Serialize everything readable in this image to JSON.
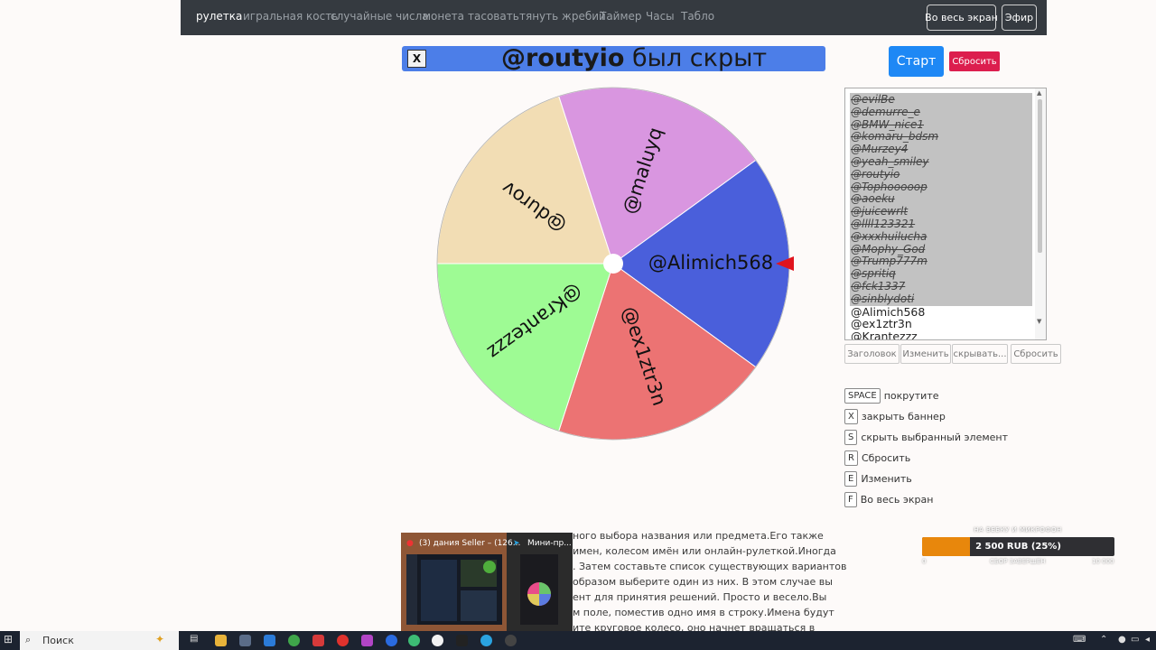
{
  "nav": {
    "items": [
      "рулетка",
      "игральная кость",
      "случайные числа",
      "монета",
      "тасовать",
      "тянуть жребий",
      "Таймер",
      "Часы",
      "Табло"
    ],
    "fullscreen_label": "Во весь экран",
    "broadcast_label": "Эфир"
  },
  "banner": {
    "close_label": "X",
    "name": "@routyio",
    "suffix": " был скрыт"
  },
  "wheel": {
    "segments": [
      {
        "label": "@Alimich568",
        "color": "#4a5fdb"
      },
      {
        "label": "@ex1ztr3n",
        "color": "#ec7373"
      },
      {
        "label": "@Krantezzz",
        "color": "#9efb94"
      },
      {
        "label": "@durov",
        "color": "#f2ddb4"
      },
      {
        "label": "@maluyq",
        "color": "#d996e0"
      }
    ],
    "pointer_color": "#e0141e"
  },
  "controls": {
    "start_label": "Старт",
    "reset_label": "Сбросить"
  },
  "list": {
    "hidden": [
      "@evilBe",
      "@demurre_e",
      "@BMW_nice1",
      "@komaru_bdsm",
      "@Murzey4",
      "@yeah_smiley",
      "@routyio",
      "@Tophooooop",
      "@aoeku",
      "@juicewrlt",
      "@llll123321",
      "@xxxhuilucha",
      "@Mophy_God",
      "@Trump777m",
      "@spritiq",
      "@fck1337",
      "@sinblydoti"
    ],
    "visible": [
      "@Alimich568",
      "@ex1ztr3n",
      "@Krantezzz"
    ],
    "buttons": [
      "Заголовок",
      "Изменить",
      "скрывать...",
      "Сбросить"
    ]
  },
  "shortcuts": [
    {
      "key": "SPACE",
      "label": "покрутите"
    },
    {
      "key": "X",
      "label": "закрыть баннер"
    },
    {
      "key": "S",
      "label": "скрыть выбранный элемент"
    },
    {
      "key": "R",
      "label": "Сбросить"
    },
    {
      "key": "E",
      "label": "Изменить"
    },
    {
      "key": "F",
      "label": "Во весь экран"
    }
  ],
  "description": [
    "ного выбора названия или предмета.Его также",
    "имен, колесом имён или онлайн-рулеткой.Иногда",
    ". Затем составьте список существующих вариантов",
    "образом выберите один из них. В этом случае вы",
    "ент для принятия решений. Просто и весело.Вы",
    "м поле, поместив одно имя в строку.Имена будут",
    "ите круговое колесо, оно начнет вращаться в"
  ],
  "preview": {
    "window_a": "(3) дания Seller – (126...",
    "window_b": "Мини-пр..."
  },
  "fundraiser": {
    "title": "НА ВЕБКУ И МИКРОФОН",
    "amount_text": "2 500 RUB (25%)",
    "progress": 0.25,
    "min": "0",
    "status": "СБОР ЗАВЕРШЕН",
    "max": "10 000"
  },
  "taskbar": {
    "search_placeholder": "Поиск"
  }
}
